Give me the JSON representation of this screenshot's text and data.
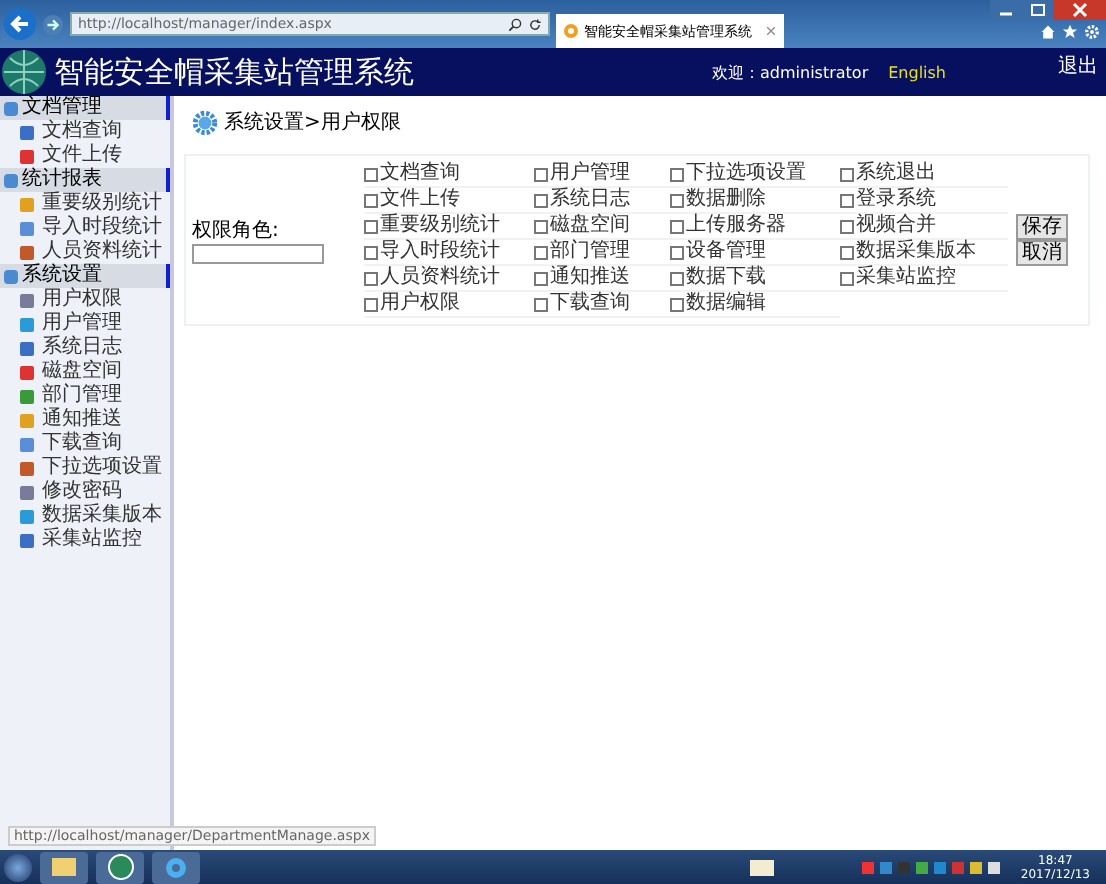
{
  "browser": {
    "address": "http://localhost/manager/index.aspx",
    "tab_title": "智能安全帽采集站管理系统"
  },
  "header": {
    "title": "智能安全帽采集站管理系统",
    "welcome": "欢迎：administrator",
    "language_link": "English",
    "logout": "退出"
  },
  "sidebar": {
    "groups": [
      {
        "title": "文档管理",
        "items": [
          "文档查询",
          "文件上传"
        ]
      },
      {
        "title": "统计报表",
        "items": [
          "重要级别统计",
          "导入时段统计",
          "人员资料统计"
        ]
      },
      {
        "title": "系统设置",
        "items": [
          "用户权限",
          "用户管理",
          "系统日志",
          "磁盘空间",
          "部门管理",
          "通知推送",
          "下载查询",
          "下拉选项设置",
          "修改密码",
          "数据采集版本",
          "采集站监控"
        ]
      }
    ]
  },
  "breadcrumb": "系统设置>用户权限",
  "role_label": "权限角色:",
  "permissions": [
    {
      "label": "文档查询",
      "checked": false
    },
    {
      "label": "用户管理",
      "checked": false
    },
    {
      "label": "下拉选项设置",
      "checked": false
    },
    {
      "label": "系统退出",
      "checked": false
    },
    {
      "label": "文件上传",
      "checked": false
    },
    {
      "label": "系统日志",
      "checked": false
    },
    {
      "label": "数据删除",
      "checked": false
    },
    {
      "label": "登录系统",
      "checked": false
    },
    {
      "label": "重要级别统计",
      "checked": false
    },
    {
      "label": "磁盘空间",
      "checked": false
    },
    {
      "label": "上传服务器",
      "checked": false
    },
    {
      "label": "视频合并",
      "checked": false
    },
    {
      "label": "导入时段统计",
      "checked": false
    },
    {
      "label": "部门管理",
      "checked": false
    },
    {
      "label": "设备管理",
      "checked": false
    },
    {
      "label": "数据采集版本",
      "checked": false
    },
    {
      "label": "人员资料统计",
      "checked": false
    },
    {
      "label": "通知推送",
      "checked": false
    },
    {
      "label": "数据下载",
      "checked": false
    },
    {
      "label": "采集站监控",
      "checked": false
    },
    {
      "label": "用户权限",
      "checked": false
    },
    {
      "label": "下载查询",
      "checked": false
    },
    {
      "label": "数据编辑",
      "checked": false
    }
  ],
  "buttons": [
    "保存",
    "取消"
  ],
  "status_url": "http://localhost/manager/DepartmentManage.aspx",
  "taskbar": {
    "time": "18:47",
    "date": "2017/12/13"
  }
}
